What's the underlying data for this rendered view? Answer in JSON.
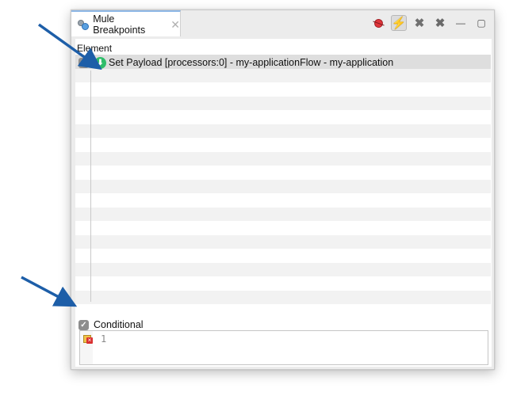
{
  "tab": {
    "title": "Mule Breakpoints",
    "close_glyph": "✕"
  },
  "toolbar": {
    "icons": [
      "breakpoint-icon",
      "lightning-bolt-icon",
      "remove-all-icon",
      "remove-icon",
      "minimize-icon",
      "maximize-icon"
    ],
    "bolt_glyph": "⚡",
    "remove_all_glyph": "✖",
    "remove_glyph": "✖",
    "minimize_glyph": "—",
    "maximize_glyph": "▢"
  },
  "table": {
    "column_header": "Element",
    "rows": [
      {
        "checked": true,
        "icon": "set-payload-icon",
        "text": "Set Payload [processors:0] - my-applicationFlow - my-application"
      }
    ]
  },
  "conditional": {
    "label": "Conditional",
    "checked": true
  },
  "editor": {
    "line_number": "1"
  },
  "colors": {
    "arrow": "#1d5ea8",
    "set_payload_icon": "#2fbd6a",
    "selected_row": "#dedede",
    "tab_accent": "#8db7e6"
  },
  "glyphs": {
    "check": "✓",
    "download": "⬇"
  }
}
